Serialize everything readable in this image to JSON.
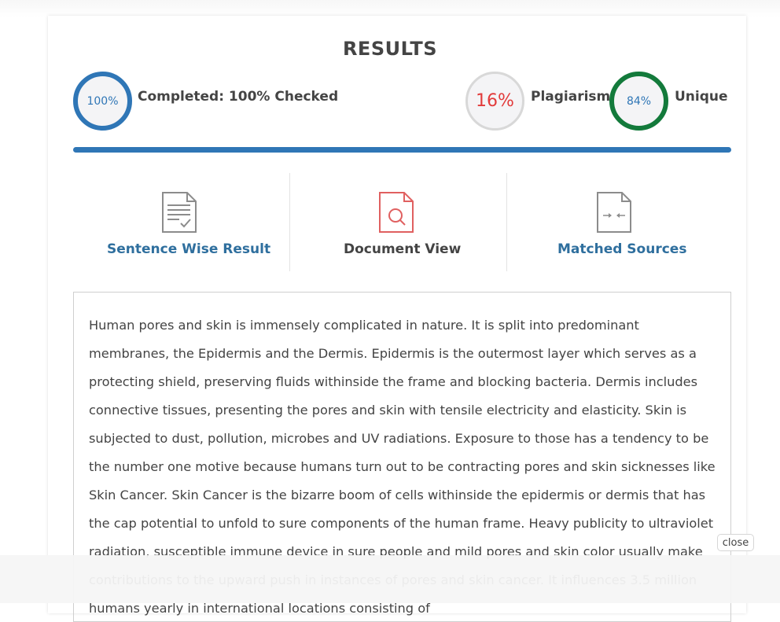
{
  "results": {
    "title": "RESULTS",
    "completed": {
      "percent_text": "100%",
      "label": "Completed: 100% Checked",
      "value": 100
    },
    "plagiarism": {
      "percent_text": "16%",
      "label": "Plagiarism",
      "value": 16
    },
    "unique": {
      "percent_text": "84%",
      "label": "Unique",
      "value": 84
    },
    "progress_fraction": 1.0
  },
  "tools": [
    {
      "label": "Sentence Wise Result",
      "icon": "checklist-document-icon"
    },
    {
      "label": "Document View",
      "icon": "document-search-icon"
    },
    {
      "label": "Matched Sources",
      "icon": "compare-arrows-document-icon"
    }
  ],
  "content": {
    "text": "Human pores and skin is immensely complicated in nature. It is split into predominant membranes, the Epidermis and the Dermis. Epidermis is the outermost layer which serves as a protecting shield, preserving fluids withinside the frame and blocking bacteria. Dermis includes connective tissues, presenting the pores and skin with tensile electricity and elasticity. Skin is subjected to dust, pollution, microbes and UV radiations. Exposure to those has a tendency to be the number one motive because humans turn out to be contracting pores and skin sicknesses like Skin Cancer. Skin Cancer is the bizarre boom of cells withinside the epidermis or dermis that has the cap potential to unfold to sure components of the human frame. Heavy publicity to ultraviolet radiation, susceptible immune device in sure people and mild pores and skin color usually make contributions to the upward push in instances of pores and skin cancer. It influences 3.5 million humans yearly in international locations consisting of"
  },
  "overlay": {
    "close_label": "close"
  },
  "colors": {
    "accent_blue": "#2f76b6",
    "plagiarism_red": "#e23b3b",
    "unique_green": "#137a3b",
    "link_blue": "#2f6f9e"
  }
}
